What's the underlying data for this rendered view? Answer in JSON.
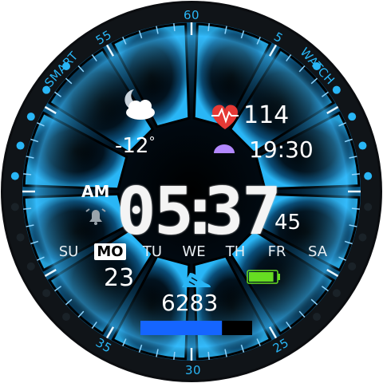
{
  "bezel": {
    "brand_left": "SMART",
    "brand_right": "WATCH",
    "marks": {
      "top": "60",
      "top_right": "5",
      "top_left": "55",
      "bottom": "30",
      "bottom_left": "35",
      "bottom_right": "25"
    }
  },
  "weather": {
    "icon": "cloud-moon-icon",
    "temperature": "-12",
    "unit": "°"
  },
  "heart": {
    "icon": "heart-pulse-icon",
    "bpm": "114",
    "color": "#e53935"
  },
  "sunset": {
    "icon": "sunset-icon",
    "time": "19:30",
    "color": "#b388ff"
  },
  "clock": {
    "ampm": "AM",
    "hours": "05",
    "separator": ":",
    "minutes": "37",
    "seconds": "45",
    "alarm_icon": "alarm-icon"
  },
  "week": {
    "days": [
      "SU",
      "MO",
      "TU",
      "WE",
      "TH",
      "FR",
      "SA"
    ],
    "selected": "MO"
  },
  "date": {
    "day": "23"
  },
  "steps": {
    "icon": "shoe-icon",
    "count": "6283",
    "progress": 0.73,
    "bar_color": "#1565ff"
  },
  "battery": {
    "icon": "battery-icon",
    "level": 0.9,
    "color": "#66dd22"
  },
  "theme": {
    "accent": "#29b6f6",
    "panel_dark": "#03131f",
    "panel_blue": "#0d4f7a"
  }
}
